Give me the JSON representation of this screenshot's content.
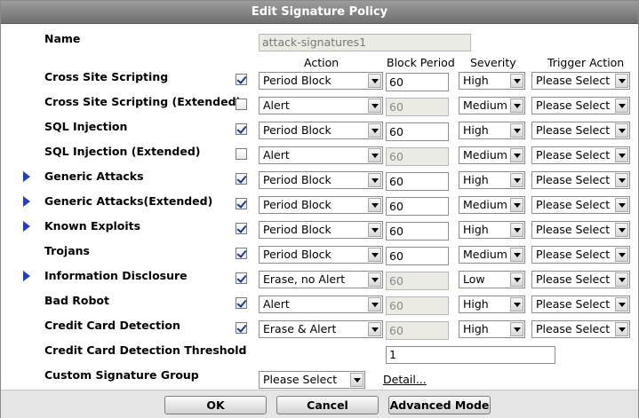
{
  "dialog": {
    "title": "Edit Signature Policy"
  },
  "name_label": "Name",
  "name_value": "attack-signatures1",
  "columns": {
    "action": "Action",
    "block_period": "Block Period",
    "severity": "Severity",
    "trigger_action": "Trigger Action"
  },
  "rows": [
    {
      "label": "Cross Site Scripting",
      "checked": true,
      "expandable": false,
      "action": "Period Block",
      "block_period": "60",
      "block_enabled": true,
      "severity": "High",
      "trigger": "Please Select"
    },
    {
      "label": "Cross Site Scripting (Extended)",
      "checked": false,
      "expandable": false,
      "action": "Alert",
      "block_period": "60",
      "block_enabled": false,
      "severity": "Medium",
      "trigger": "Please Select"
    },
    {
      "label": "SQL Injection",
      "checked": true,
      "expandable": false,
      "action": "Period Block",
      "block_period": "60",
      "block_enabled": true,
      "severity": "High",
      "trigger": "Please Select"
    },
    {
      "label": "SQL Injection (Extended)",
      "checked": false,
      "expandable": false,
      "action": "Alert",
      "block_period": "60",
      "block_enabled": false,
      "severity": "Medium",
      "trigger": "Please Select"
    },
    {
      "label": "Generic Attacks",
      "checked": true,
      "expandable": true,
      "action": "Period Block",
      "block_period": "60",
      "block_enabled": true,
      "severity": "High",
      "trigger": "Please Select"
    },
    {
      "label": "Generic Attacks(Extended)",
      "checked": true,
      "expandable": true,
      "action": "Period Block",
      "block_period": "60",
      "block_enabled": true,
      "severity": "Medium",
      "trigger": "Please Select"
    },
    {
      "label": "Known Exploits",
      "checked": true,
      "expandable": true,
      "action": "Period Block",
      "block_period": "60",
      "block_enabled": true,
      "severity": "High",
      "trigger": "Please Select"
    },
    {
      "label": "Trojans",
      "checked": true,
      "expandable": false,
      "action": "Period Block",
      "block_period": "60",
      "block_enabled": true,
      "severity": "Medium",
      "trigger": "Please Select"
    },
    {
      "label": "Information Disclosure",
      "checked": true,
      "expandable": true,
      "action": "Erase, no Alert",
      "block_period": "60",
      "block_enabled": false,
      "severity": "Low",
      "trigger": "Please Select"
    },
    {
      "label": "Bad Robot",
      "checked": true,
      "expandable": false,
      "action": "Alert",
      "block_period": "60",
      "block_enabled": false,
      "severity": "High",
      "trigger": "Please Select"
    },
    {
      "label": "Credit Card Detection",
      "checked": true,
      "expandable": false,
      "action": "Erase & Alert",
      "block_period": "60",
      "block_enabled": false,
      "severity": "High",
      "trigger": "Please Select"
    }
  ],
  "threshold": {
    "label": "Credit Card Detection Threshold",
    "value": "1"
  },
  "custom_group": {
    "label": "Custom Signature Group",
    "value": "Please Select",
    "detail_link": "Detail..."
  },
  "buttons": {
    "ok": "OK",
    "cancel": "Cancel",
    "advanced": "Advanced Mode"
  },
  "colors": {
    "title_bar": "#7f7f7f",
    "expand_arrow": "#1e3ec8",
    "footer": "#e6e6e6",
    "disabled_field": "#ebebe4"
  }
}
